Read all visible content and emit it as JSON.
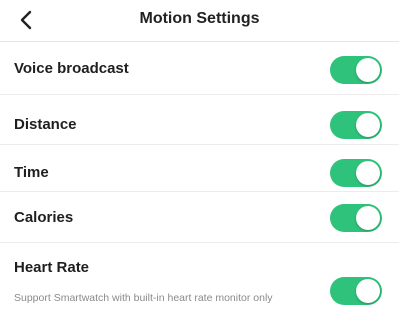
{
  "header": {
    "back_icon": "chevron-left-icon",
    "title": "Motion Settings"
  },
  "settings": [
    {
      "label": "Voice broadcast",
      "enabled": true
    },
    {
      "label": "Distance",
      "enabled": true
    },
    {
      "label": "Time",
      "enabled": true
    },
    {
      "label": "Calories",
      "enabled": true
    },
    {
      "label": "Heart Rate",
      "description": "Support Smartwatch with built-in heart rate monitor only",
      "enabled": true
    }
  ],
  "colors": {
    "toggle_on": "#2fc27b",
    "knob": "#ffffff"
  }
}
